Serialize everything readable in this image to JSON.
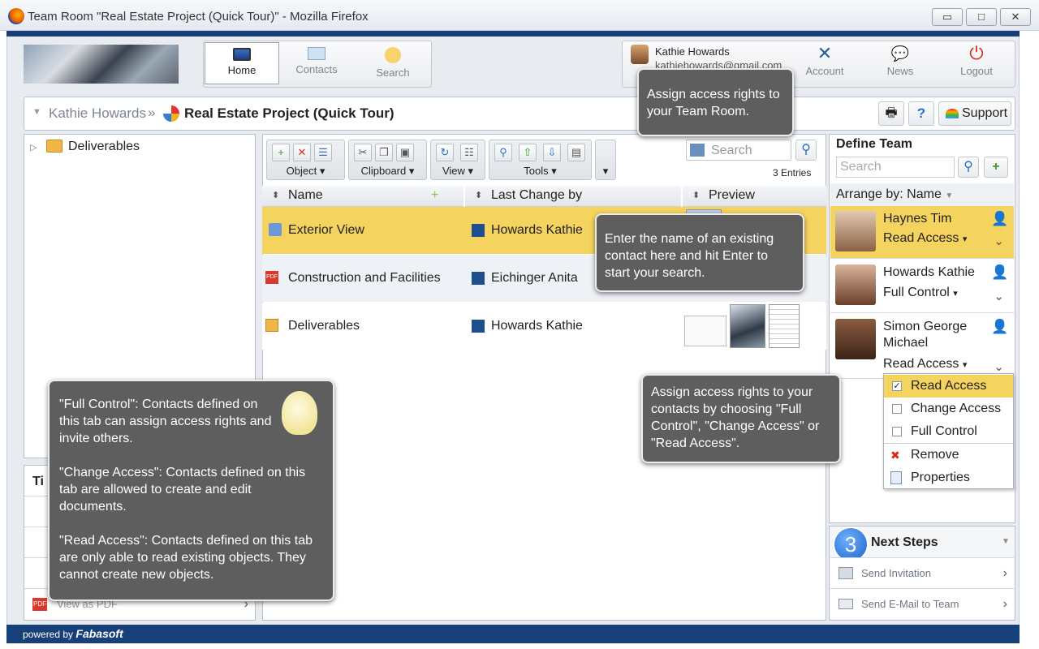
{
  "window": {
    "title": "Team Room \"Real Estate Project (Quick Tour)\" - Mozilla Firefox",
    "min": "▭",
    "max": "□",
    "close": "✕"
  },
  "nav": {
    "tabs": [
      {
        "label": "Home",
        "icon": "monitor-icon"
      },
      {
        "label": "Contacts",
        "icon": "contacts-icon"
      },
      {
        "label": "Search",
        "icon": "search-icon"
      }
    ]
  },
  "user": {
    "name": "Kathie Howards",
    "email": "kathiehowards@gmail.com"
  },
  "topActions": [
    {
      "label": "Account",
      "icon": "tools-icon"
    },
    {
      "label": "News",
      "icon": "speech-bubble-icon"
    },
    {
      "label": "Logout",
      "icon": "power-icon"
    }
  ],
  "breadcrumb": {
    "parent": "Kathie Howards",
    "separator": "»",
    "current": "Real Estate Project (Quick Tour)"
  },
  "headerButtons": {
    "support": "Support",
    "help": "?"
  },
  "tree": {
    "root": "Deliverables"
  },
  "toolbar": {
    "groups": [
      {
        "label": "Object"
      },
      {
        "label": "Clipboard"
      },
      {
        "label": "View"
      },
      {
        "label": "Tools"
      }
    ],
    "search_placeholder": "Search",
    "entries": "3 Entries"
  },
  "table": {
    "columns": [
      "Name",
      "Last Change by",
      "Preview"
    ],
    "rows": [
      {
        "name": "Exterior View",
        "changed_by": "Howards Kathie"
      },
      {
        "name": "Construction and Facilities",
        "changed_by": "Eichinger Anita"
      },
      {
        "name": "Deliverables",
        "changed_by": "Howards Kathie"
      }
    ]
  },
  "team": {
    "title": "Define Team",
    "search_placeholder": "Search",
    "arrange_label": "Arrange by:",
    "arrange_value": "Name",
    "members": [
      {
        "name": "Haynes Tim",
        "access": "Read Access"
      },
      {
        "name": "Howards Kathie",
        "access": "Full Control"
      },
      {
        "name": "Simon George Michael",
        "access": "Read Access"
      }
    ]
  },
  "accessMenu": {
    "options": [
      "Read Access",
      "Change Access",
      "Full Control"
    ],
    "actions": [
      "Remove",
      "Properties"
    ]
  },
  "nextSteps": {
    "number": "3",
    "title": "Next Steps",
    "items": [
      "Send Invitation",
      "Send E-Mail to Team"
    ]
  },
  "tips": {
    "title": "Ti",
    "last_item": "View as PDF"
  },
  "tooltips": {
    "access": "Assign access rights to your Team Room.",
    "search": "Enter the name of an existing contact here and hit Enter to start your search.",
    "contacts": "Assign access rights to your contacts by choosing \"Full Control\", \"Change Access\" or \"Read Access\".",
    "full": "\"Full Control\": Contacts defined on this tab can assign access rights and invite others.",
    "change": "\"Change Access\": Contacts defined on this tab are allowed to create and edit documents.",
    "read": "\"Read Access\": Contacts defined on this tab are only able to read existing objects. They cannot create new objects."
  },
  "footer": {
    "powered": "powered by",
    "brand": "Fabasoft"
  }
}
